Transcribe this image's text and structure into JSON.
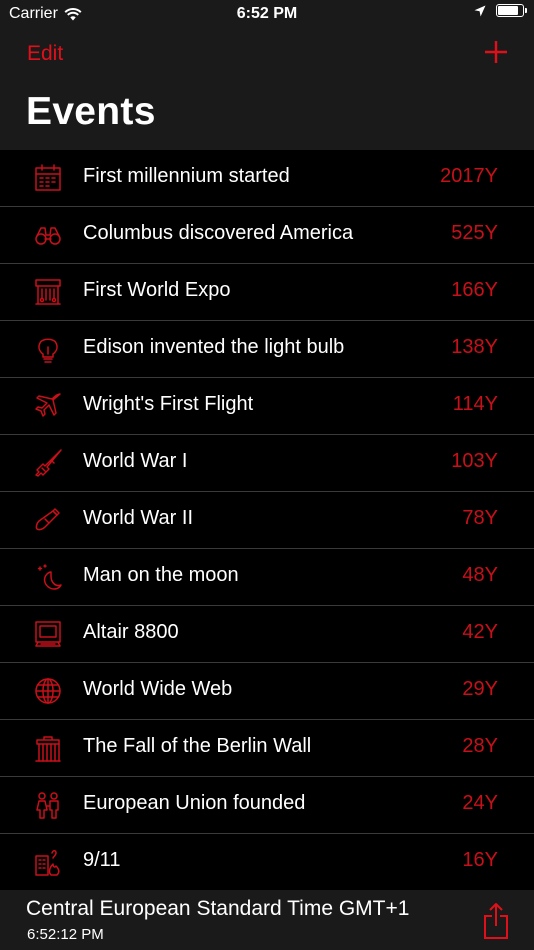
{
  "status_bar": {
    "carrier": "Carrier",
    "time": "6:52 PM",
    "battery_level": 0.85
  },
  "nav": {
    "edit_label": "Edit",
    "title": "Events",
    "add_icon": "plus-icon"
  },
  "events": [
    {
      "icon": "calendar-icon",
      "title": "First millennium started",
      "value": "2017Y"
    },
    {
      "icon": "binoculars-icon",
      "title": "Columbus discovered America",
      "value": "525Y"
    },
    {
      "icon": "expo-pavilion-icon",
      "title": "First World Expo",
      "value": "166Y"
    },
    {
      "icon": "light-bulb-icon",
      "title": "Edison invented the light bulb",
      "value": "138Y"
    },
    {
      "icon": "airplane-icon",
      "title": "Wright's First Flight",
      "value": "114Y"
    },
    {
      "icon": "rifle-icon",
      "title": "World War I",
      "value": "103Y"
    },
    {
      "icon": "bomb-icon",
      "title": "World War II",
      "value": "78Y"
    },
    {
      "icon": "moon-icon",
      "title": "Man on the moon",
      "value": "48Y"
    },
    {
      "icon": "computer-icon",
      "title": "Altair 8800",
      "value": "42Y"
    },
    {
      "icon": "globe-icon",
      "title": "World Wide Web",
      "value": "29Y"
    },
    {
      "icon": "brandenburg-gate-icon",
      "title": "The Fall of the Berlin Wall",
      "value": "28Y"
    },
    {
      "icon": "people-icon",
      "title": "European Union founded",
      "value": "24Y"
    },
    {
      "icon": "burning-building-icon",
      "title": "9/11",
      "value": "16Y"
    }
  ],
  "footer": {
    "timezone": "Central European Standard Time GMT+1",
    "clock": "6:52:12 PM",
    "share_icon": "share-icon"
  },
  "colors": {
    "accent": "#e0101a",
    "value_text": "#c8101a",
    "bar_background": "#1a1a1a",
    "list_background": "#000000",
    "separator": "#3a3a3c"
  }
}
